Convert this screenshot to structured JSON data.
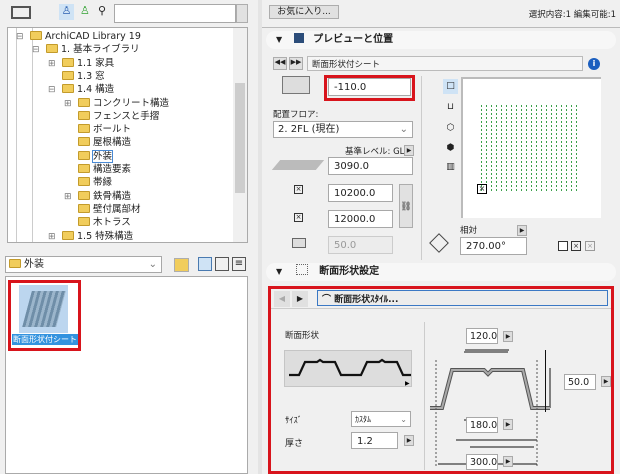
{
  "left": {
    "search_placeholder": "",
    "tree": [
      {
        "label": "ArchiCAD Library 19",
        "level": 0,
        "expander": "-"
      },
      {
        "label": "1. 基本ライブラリ",
        "level": 1,
        "expander": "-"
      },
      {
        "label": "1.1 家具",
        "level": 2,
        "expander": "+"
      },
      {
        "label": "1.3 窓",
        "level": 2,
        "expander": ""
      },
      {
        "label": "1.4 構造",
        "level": 2,
        "expander": "-"
      },
      {
        "label": "コンクリート構造",
        "level": 3,
        "expander": "+"
      },
      {
        "label": "フェンスと手摺",
        "level": 3,
        "expander": ""
      },
      {
        "label": "ボールト",
        "level": 3,
        "expander": ""
      },
      {
        "label": "屋根構造",
        "level": 3,
        "expander": ""
      },
      {
        "label": "外装",
        "level": 3,
        "expander": "",
        "selected": true
      },
      {
        "label": "構造要素",
        "level": 3,
        "expander": ""
      },
      {
        "label": "帯縁",
        "level": 3,
        "expander": ""
      },
      {
        "label": "鉄骨構造",
        "level": 3,
        "expander": "+"
      },
      {
        "label": "壁付属部材",
        "level": 3,
        "expander": ""
      },
      {
        "label": "木トラス",
        "level": 3,
        "expander": ""
      },
      {
        "label": "1.5 特殊構造",
        "level": 2,
        "expander": "+"
      }
    ],
    "folder_select": "外装",
    "item_label": "断面形状付シート"
  },
  "right": {
    "favorites_button": "お気に入り...",
    "selection_status": "選択内容:1 編集可能:1",
    "section1_title": "プレビューと位置",
    "object_name": "断面形状付シート",
    "offset_value": "-110.0",
    "floor_label": "配置フロア:",
    "floor_value": "2. 2FL (現在)",
    "ref_level_label": "基準レベル: GL",
    "height_value": "3090.0",
    "width_value": "10200.0",
    "depth_value": "12000.0",
    "thickness_disabled": "50.0",
    "relative_label": "相対",
    "angle_value": "270.00°",
    "section2_title": "断面形状設定",
    "profile_style_button": "断面形状ｽﾀｲﾙ...",
    "profile_label": "断面形状",
    "size_label": "ｻｲｽﾞ",
    "size_value": "ｶｽﾀﾑ",
    "thickness_label": "厚さ",
    "thickness_value": "1.2",
    "dim_top": "120.0",
    "dim_height": "50.0",
    "dim_bottom": "180.0",
    "dim_pitch": "300.0"
  }
}
